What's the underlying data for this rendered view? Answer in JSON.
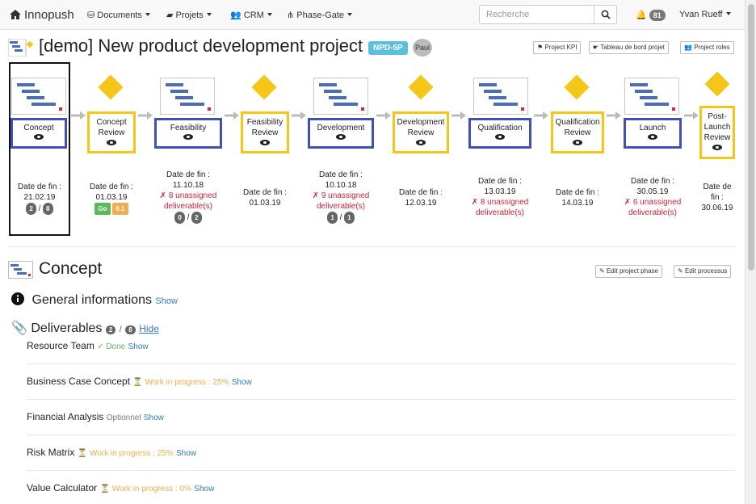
{
  "nav": {
    "brand": "Innopush",
    "documents": "Documents",
    "projets": "Projets",
    "crm": "CRM",
    "phase_gate": "Phase-Gate",
    "search_placeholder": "Recherche",
    "notifications": "81",
    "user": "Yvan Rueff"
  },
  "project": {
    "title": "[demo] New product development project",
    "code": "NPD-5P",
    "owner": "Paul",
    "btn_kpi": "Project KPI",
    "btn_dashboard": "Tableau de bord projet",
    "btn_roles": "Project roles"
  },
  "phases": [
    {
      "label": "Concept",
      "date_label": "Date de fin :",
      "date": "21.02.19",
      "done": "2",
      "total": "8"
    },
    {
      "label": "Concept Review",
      "date_label": "Date de fin :",
      "date": "01.03.19",
      "decision": "Go",
      "score": "6.1"
    },
    {
      "label": "Feasibility",
      "date_label": "Date de fin :",
      "date": "11.10.18",
      "warning": "✗ 8 unassigned deliverable(s)",
      "done": "0",
      "total": "2"
    },
    {
      "label": "Feasibility Review",
      "date_label": "Date de fin :",
      "date": "01.03.19"
    },
    {
      "label": "Development",
      "date_label": "Date de fin :",
      "date": "10.10.18",
      "warning": "✗ 9 unassigned deliverable(s)",
      "done": "1",
      "total": "1"
    },
    {
      "label": "Development Review",
      "date_label": "Date de fin :",
      "date": "12.03.19"
    },
    {
      "label": "Qualification",
      "date_label": "Date de fin :",
      "date": "13.03.19",
      "warning": "✗ 8 unassigned deliverable(s)"
    },
    {
      "label": "Qualification Review",
      "date_label": "Date de fin :",
      "date": "14.03.19"
    },
    {
      "label": "Launch",
      "date_label": "Date de fin :",
      "date": "30.05.19",
      "warning": "✗ 6 unassigned deliverable(s)"
    },
    {
      "label": "Post-Launch Review",
      "date_label": "Date de fin :",
      "date": "30.06.19"
    }
  ],
  "section": {
    "title": "Concept",
    "btn_edit_phase": "Edit project phase",
    "btn_edit_process": "Edit processus",
    "general": "General informations",
    "general_show": "Show",
    "deliverables": "Deliverables",
    "deliv_done": "2",
    "deliv_total": "8",
    "deliv_hide": "Hide"
  },
  "deliverables": [
    {
      "name": "Resource Team",
      "status": "✓ Done",
      "link": "Show"
    },
    {
      "name": "Business Case Concept",
      "status": "⏳ Work in progress : 25%",
      "link": "Show"
    },
    {
      "name": "Financial Analysis",
      "status": "Optionnel",
      "link": "Show"
    },
    {
      "name": "Risk Matrix",
      "status": "⏳ Work in progress : 25%",
      "link": "Show"
    },
    {
      "name": "Value Calculator",
      "status": "⏳ Work in progress : 0%",
      "link": "Show"
    }
  ]
}
